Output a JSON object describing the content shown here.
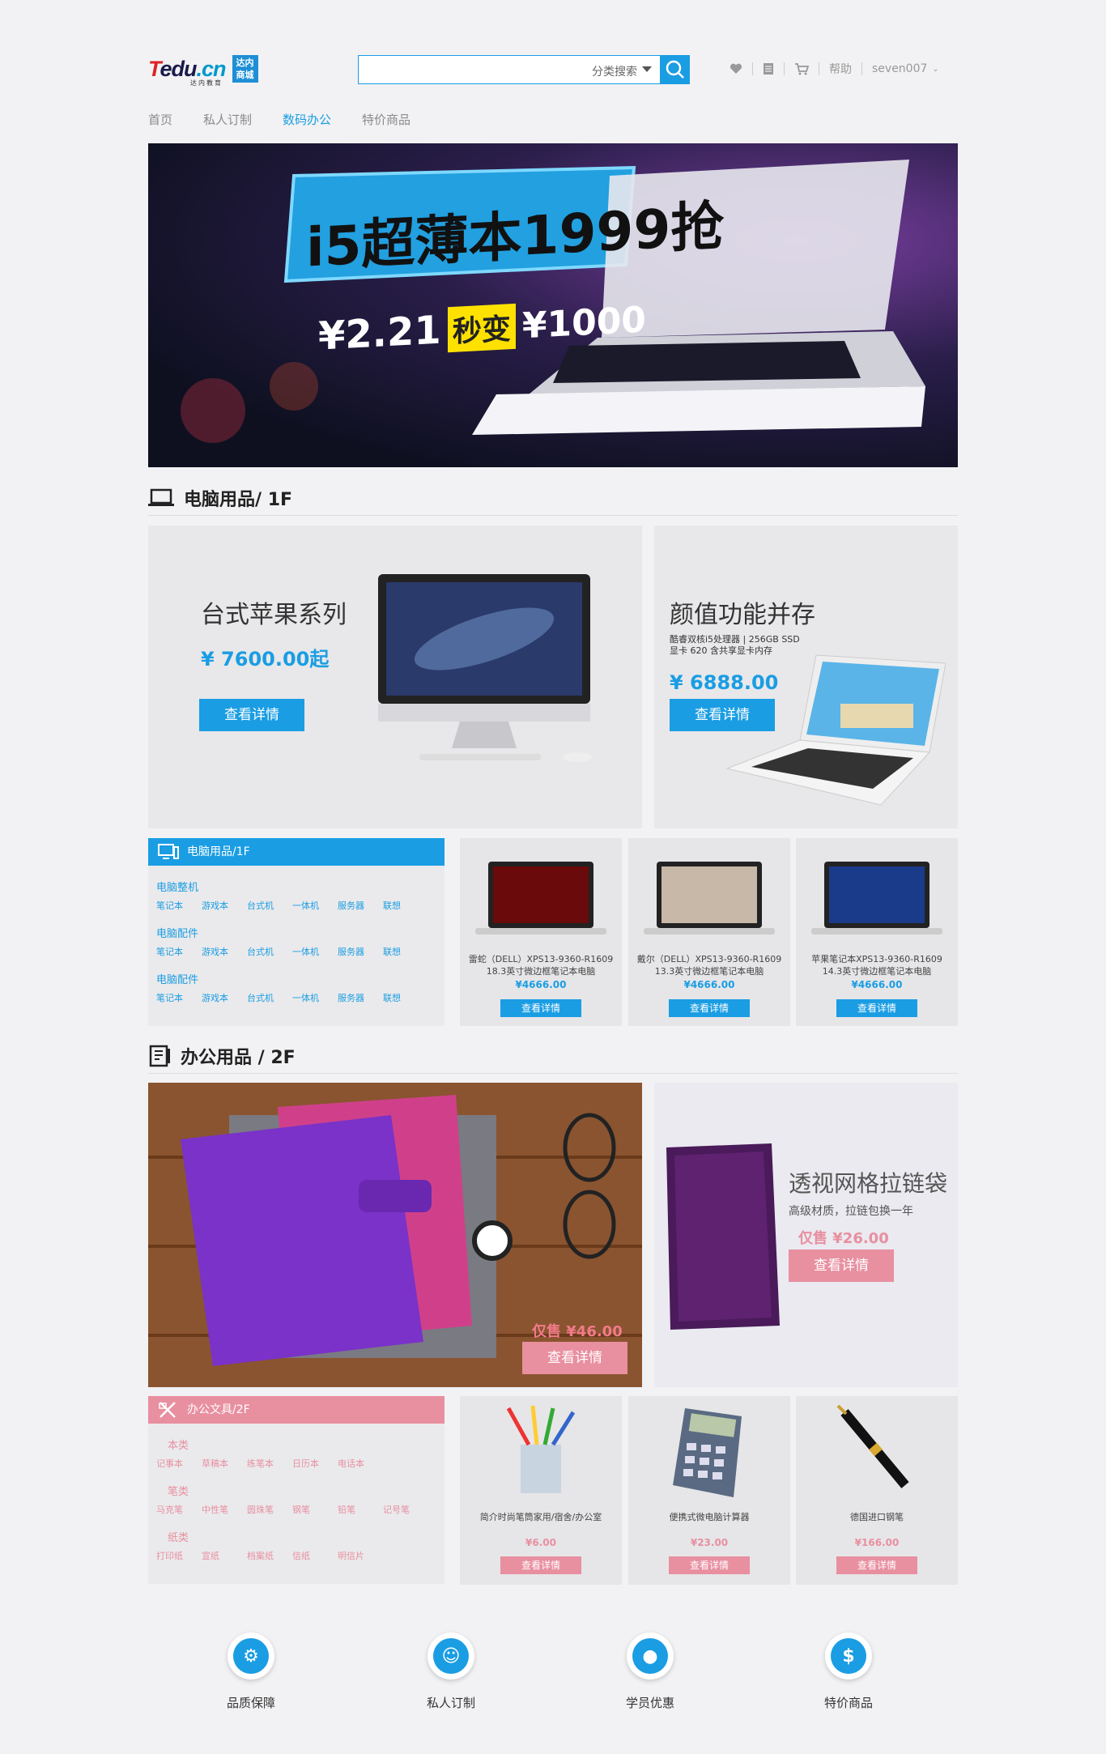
{
  "header": {
    "logo_text": "Tedu.cn",
    "logo_sub": "达内教育",
    "logo_badge": "达内商城",
    "search_placeholder": "",
    "search_category": "分类搜索",
    "help": "帮助",
    "username": "seven007"
  },
  "nav": [
    "首页",
    "私人订制",
    "数码办公",
    "特价商品"
  ],
  "nav_active": "数码办公",
  "banner": {
    "headline": "i5超薄本1999抢",
    "price_old": "¥2.21",
    "price_tag": "秒变",
    "price_new": "¥1000"
  },
  "floor1": {
    "title": "电脑用品/ 1F",
    "promo_left": {
      "title": "台式苹果系列",
      "price": "¥ 7600.00起",
      "button": "查看详情"
    },
    "promo_right": {
      "title": "颜值功能并存",
      "desc1": "酷睿双核i5处理器 | 256GB SSD",
      "desc2": "显卡 620 含共享显卡内存",
      "price": "¥ 6888.00",
      "button": "查看详情"
    },
    "category": {
      "header": "电脑用品/1F",
      "groups": [
        {
          "title": "电脑整机",
          "items": [
            "笔记本",
            "游戏本",
            "台式机",
            "一体机",
            "服务器",
            "联想"
          ]
        },
        {
          "title": "电脑配件",
          "items": [
            "笔记本",
            "游戏本",
            "台式机",
            "一体机",
            "服务器",
            "联想"
          ]
        },
        {
          "title": "电脑配件",
          "items": [
            "笔记本",
            "游戏本",
            "台式机",
            "一体机",
            "服务器",
            "联想"
          ]
        }
      ]
    },
    "products": [
      {
        "name1": "雷蛇（DELL）XPS13-9360-R1609",
        "name2": "18.3英寸微边框笔记本电脑",
        "price": "¥4666.00",
        "button": "查看详情"
      },
      {
        "name1": "戴尔（DELL）XPS13-9360-R1609",
        "name2": "13.3英寸微边框笔记本电脑",
        "price": "¥4666.00",
        "button": "查看详情"
      },
      {
        "name1": "苹果笔记本XPS13-9360-R1609",
        "name2": "14.3英寸微边框笔记本电脑",
        "price": "¥4666.00",
        "button": "查看详情"
      }
    ]
  },
  "floor2": {
    "title": "办公用品 / 2F",
    "promo_left": {
      "price": "仅售 ¥46.00",
      "button": "查看详情"
    },
    "promo_right": {
      "title": "透视网格拉链袋",
      "desc": "高级材质，拉链包换一年",
      "price": "仅售 ¥26.00",
      "button": "查看详情"
    },
    "category": {
      "header": "办公文具/2F",
      "groups": [
        {
          "title": "本类",
          "items": [
            "记事本",
            "草稿本",
            "练笔本",
            "日历本",
            "电话本"
          ]
        },
        {
          "title": "笔类",
          "items": [
            "马克笔",
            "中性笔",
            "圆珠笔",
            "钢笔",
            "铅笔",
            "记号笔"
          ]
        },
        {
          "title": "纸类",
          "items": [
            "打印纸",
            "宣纸",
            "档案纸",
            "信纸",
            "明信片"
          ]
        }
      ]
    },
    "products": [
      {
        "name": "简介时尚笔筒家用/宿舍/办公室",
        "price": "¥6.00",
        "button": "查看详情"
      },
      {
        "name": "便携式微电脑计算器",
        "price": "¥23.00",
        "button": "查看详情"
      },
      {
        "name": "德国进口钢笔",
        "price": "¥166.00",
        "button": "查看详情"
      }
    ]
  },
  "footer": [
    {
      "label": "品质保障",
      "icon": "gear-icon"
    },
    {
      "label": "私人订制",
      "icon": "people-icon"
    },
    {
      "label": "学员优惠",
      "icon": "user-icon"
    },
    {
      "label": "特价商品",
      "icon": "dollar-icon"
    }
  ],
  "colors": {
    "accent": "#1a9de3",
    "pink": "#e88fa0"
  }
}
